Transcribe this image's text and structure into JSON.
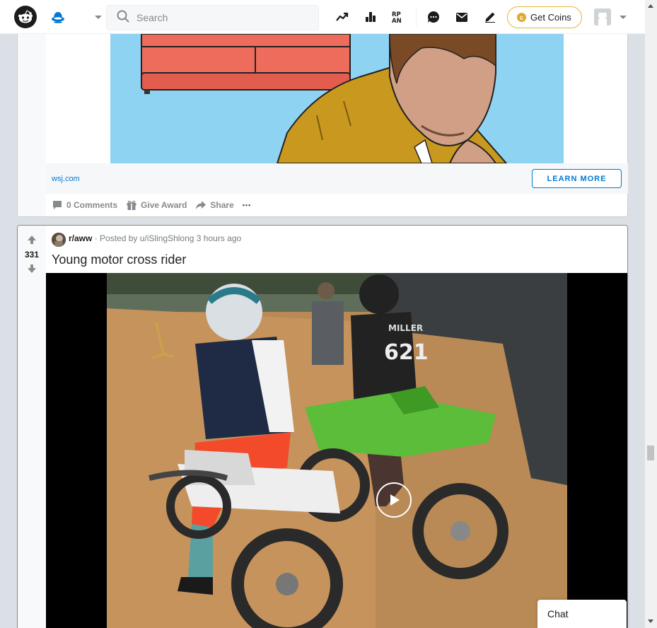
{
  "header": {
    "search_placeholder": "Search",
    "get_coins_label": "Get Coins",
    "coin_symbol": "c",
    "icons": [
      "trending-icon",
      "stats-icon",
      "rpan-icon",
      "chat-icon",
      "mail-icon",
      "pencil-icon"
    ]
  },
  "ad": {
    "domain": "wsj.com",
    "learn_more_label": "LEARN MORE",
    "actions": {
      "comments": "0 Comments",
      "award": "Give Award",
      "share": "Share",
      "more": "•••"
    }
  },
  "post": {
    "vote_count": "331",
    "subreddit": "r/aww",
    "posted_by": "· Posted by u/iSlingShlong 3 hours ago",
    "title": "Young motor cross rider",
    "rider_number": "621",
    "rider_name": "MILLER"
  },
  "chat": {
    "label": "Chat"
  },
  "colors": {
    "accent_blue": "#0079d3",
    "coin_gold": "#dfa931",
    "sky": "#8fd3f2",
    "couch": "#ee6c5c",
    "jacket": "#c9981e",
    "dirt": "#b98a55",
    "bike_green": "#5bbd3a"
  }
}
